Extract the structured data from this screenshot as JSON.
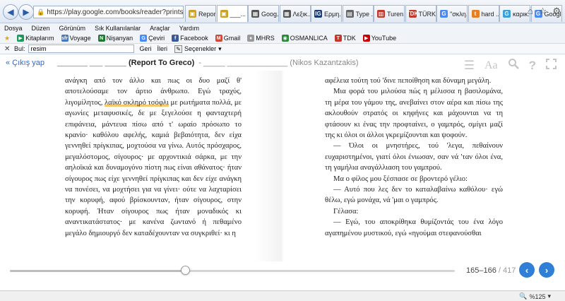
{
  "browser": {
    "url": "https://play.google.com/books/reader?printsec=fr",
    "tabs": [
      {
        "label": "Repor...",
        "fav_color": "#c9a227",
        "fav_glyph": "▣",
        "active": false
      },
      {
        "label": "___...",
        "fav_color": "#c9a227",
        "fav_glyph": "▣",
        "active": true
      },
      {
        "label": "Goog...",
        "fav_color": "#555555",
        "fav_glyph": "▦",
        "active": false
      },
      {
        "label": "Λεξικ...",
        "fav_color": "#555555",
        "fav_glyph": "▦",
        "active": false
      },
      {
        "label": "Ερμη...",
        "fav_color": "#1a3a7a",
        "fav_glyph": "IG",
        "active": false
      },
      {
        "label": "Type ...",
        "fav_color": "#666666",
        "fav_glyph": "▤",
        "active": false
      },
      {
        "label": "Turen...",
        "fav_color": "#c0392b",
        "fav_glyph": "▥",
        "active": false
      },
      {
        "label": "TÜRK...",
        "fav_color": "#c0392b",
        "fav_glyph": "TDK",
        "active": false
      },
      {
        "label": "\"σκλη...",
        "fav_color": "#4a8af4",
        "fav_glyph": "G",
        "active": false
      },
      {
        "label": "hard ...",
        "fav_color": "#e67e22",
        "fav_glyph": "t",
        "active": false
      },
      {
        "label": "καρικ...",
        "fav_color": "#3aa0d8",
        "fav_glyph": "G",
        "active": false
      },
      {
        "label": "Google",
        "fav_color": "#4a8af4",
        "fav_glyph": "G",
        "active": false
      }
    ]
  },
  "menu": [
    "Dosya",
    "Düzen",
    "Görünüm",
    "Sık Kullanılanlar",
    "Araçlar",
    "Yardım"
  ],
  "favorites": [
    {
      "label": "Kitaplarım",
      "color": "#1a9a5a",
      "glyph": "▶"
    },
    {
      "label": "Voyage",
      "color": "#4477bb",
      "glyph": "sfr"
    },
    {
      "label": "Nişanyan",
      "color": "#227733",
      "glyph": "N"
    },
    {
      "label": "Çeviri",
      "color": "#4a8af4",
      "glyph": "G"
    },
    {
      "label": "Facebook",
      "color": "#3b5998",
      "glyph": "f"
    },
    {
      "label": "Gmail",
      "color": "#d14836",
      "glyph": "M"
    },
    {
      "label": "MHRS",
      "color": "#999999",
      "glyph": "♦"
    },
    {
      "label": "OSMANLICA",
      "color": "#2a8a3a",
      "glyph": "◉"
    },
    {
      "label": "TDK",
      "color": "#c0392b",
      "glyph": "T"
    },
    {
      "label": "YouTube",
      "color": "#cc0000",
      "glyph": "▶"
    }
  ],
  "find_bar": {
    "label": "Bul:",
    "value": "resim",
    "prev": "Geri",
    "next": "İleri",
    "options": "Seçenekler"
  },
  "reader": {
    "back": "« Çıkış yap",
    "title": "_______ ___ _____ (Report To Greco)",
    "author": "- _____ ______________ (Nikos Kazantzakis)",
    "tool_icons": [
      "menu-icon",
      "font-size-icon",
      "search-icon",
      "help-icon",
      "fullscreen-icon"
    ]
  },
  "left_page": {
    "lines_before_hl": "ανάγκη από τον άλλο και πως οι δυο μαζί θ' αποτελούσαμε τον άρτιο άνθρωπο. Εγώ τραχύς, λιγομίλητος, ",
    "highlight": "λαϊκό σκληρό τσόφλι",
    "lines_after_hl": " με ρωτήματα πολλά, με αγωνίες μεταφυσικές, δε με ξεγελούσε η φανταχτερή επιφάνεια, μάντευα πίσω από τ' ωραίο πρόσωπο το κρανίο· καθόλου αφελής, καμιά βεβαιότητα, δεν είχα γεννηθεί πρίγκιπας, μοχτούσα να γίνω. Αυτός πρόσχαρος, μεγαλόστομος, σίγουρος· με αρχοντικιά σάρκα, με την αηλοϊκιά και δυναμογόνο πίστη πως είναι αθάνατος· ήταν σίγουρος πως είχε γεννηθεί πρίγκιπας και δεν είχε ανάγκη να πονέσει, να μοχτήσει για να γίνει· ούτε να λαχταρίσει την κορυφή, αφού βρίσκουνταν, ήταν σίγουρος, στην κορυφή. Ήταν σίγουρος πως ήταν μοναδικός κι αναντικατάστατος· με κανένα ζωντανό ή πεθαμένο μεγάλο δημιουργό δεν καταδέχουνταν να συγκριθεί· κι η"
  },
  "right_page": {
    "paragraphs": [
      {
        "indent": false,
        "text": "αφέλεια τούτη τού 'δινε πεποίθηση και δύναμη μεγάλη."
      },
      {
        "indent": true,
        "text": "Μια φορά του μιλούσα πώς η μέλισσα η βασιλομάνα, τη μέρα του γάμου της, ανεβαίνει στον αέρα και πίσω της ακλουθούν στρατός οι κηφήνες και μάχουνται να τη φτάσουν κι ένας την προφταίνει, ο γαμπρός, σμίγει μαζί της κι όλοι οι άλλοι γκρεμίζουνται και ψοφούν."
      },
      {
        "indent": true,
        "text": "— Όλοι οι μνηστήρες, τού 'λεγα, πεθαίνουν ευχαριστημένοι, γιατί όλοι ένιωσαν, σαν νά 'ταν όλοι ένα, τη γαμήλια αναγάλλιαση του γαμπρού."
      },
      {
        "indent": true,
        "text": "Μα ο φίλος μου ξέσπασε σε βροντερό γέλιο:"
      },
      {
        "indent": true,
        "text": "— Αυτό που λες δεν το καταλαβαίνω καθόλου· εγώ θέλω, εγώ μονάχα, νά 'μαι ο γαμπρός."
      },
      {
        "indent": true,
        "text": "Γέλασα:"
      },
      {
        "indent": true,
        "text": "— Εγώ, του αποκρίθηκα θυμίζοντάς του ένα λόγο αγαπημένου μυστικού, εγώ «ηγούμαι στεφανούσθαι"
      }
    ]
  },
  "progress": {
    "pages": "165–166",
    "total": "/ 417",
    "fraction": 0.394
  },
  "status": {
    "zoom": "%125"
  }
}
